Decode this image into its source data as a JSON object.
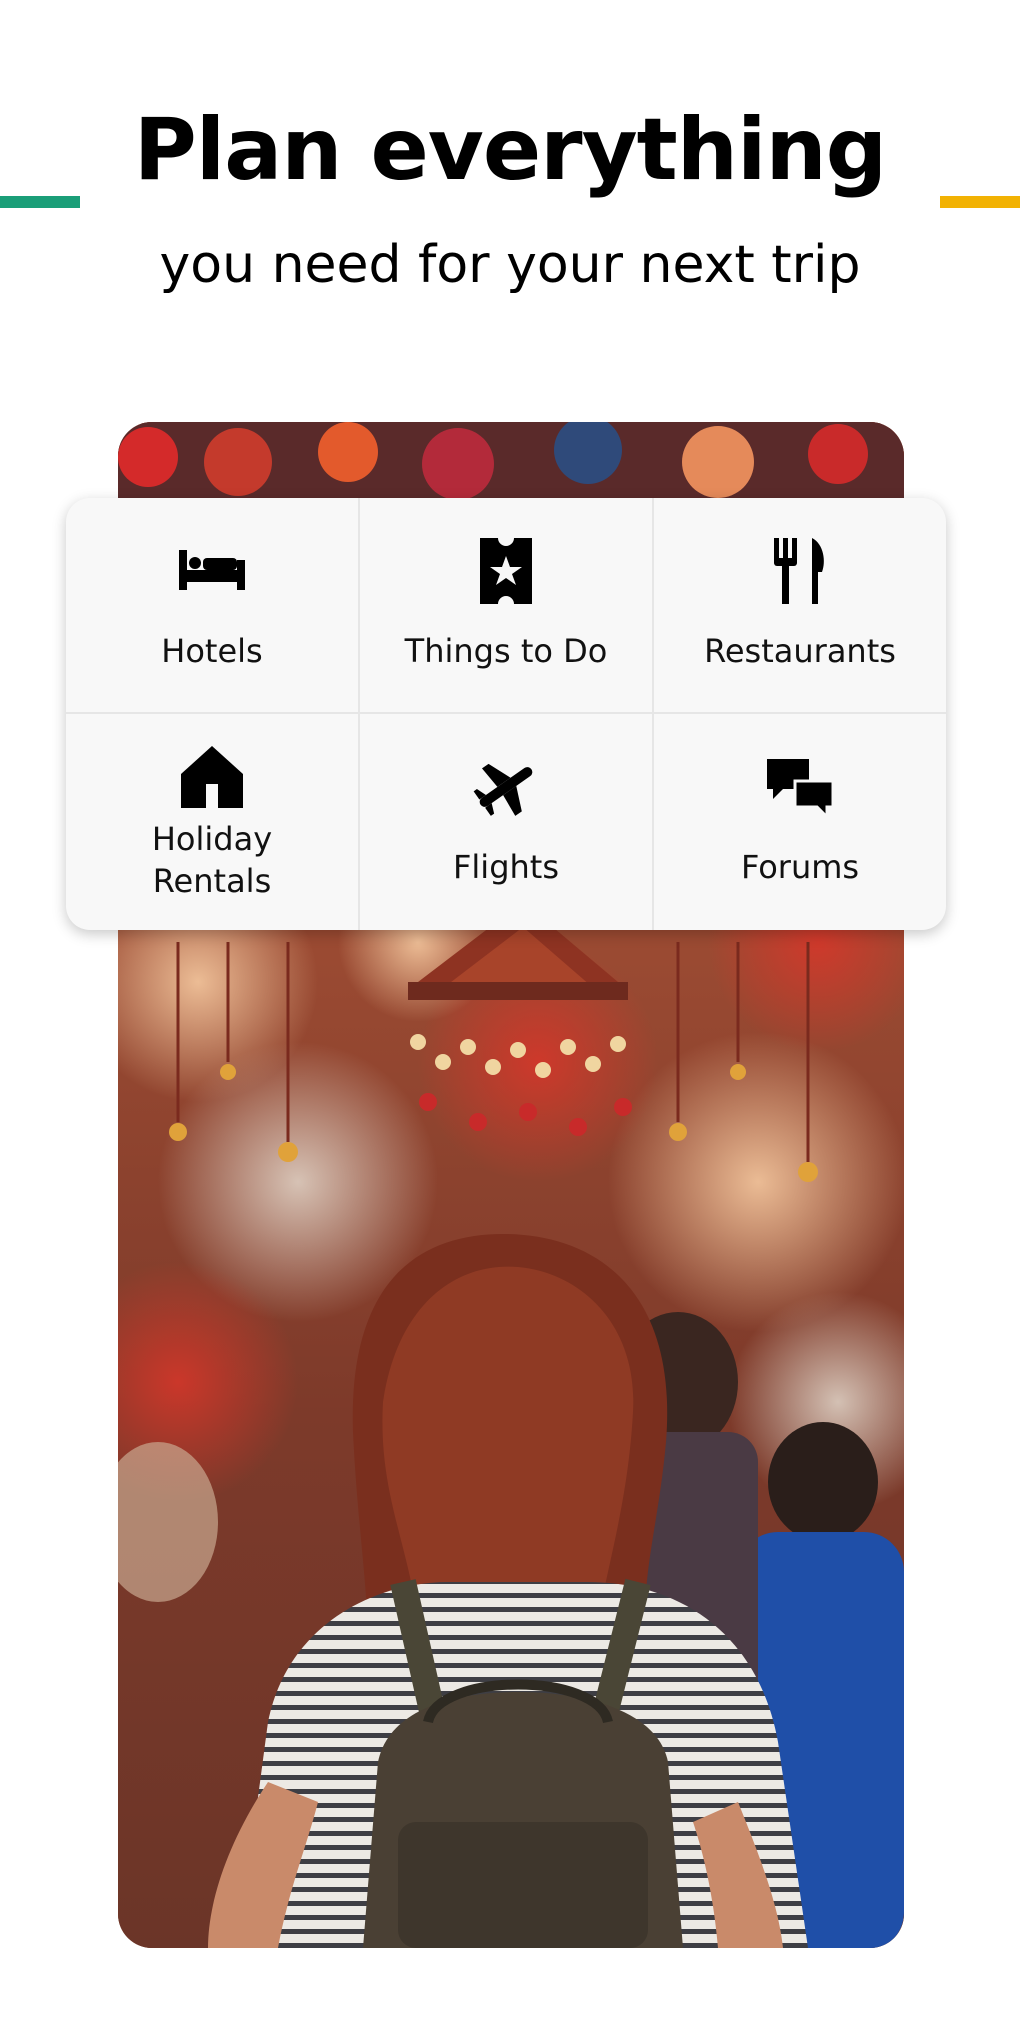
{
  "header": {
    "title": "Plan everything",
    "subtitle": "you need for your next trip"
  },
  "colors": {
    "accent_green": "#1a9e78",
    "accent_yellow": "#f2b203",
    "card_background": "#f8f8f8",
    "icon_color": "#000000"
  },
  "categories": [
    {
      "label": "Hotels",
      "icon": "bed-icon"
    },
    {
      "label": "Things to Do",
      "icon": "ticket-star-icon"
    },
    {
      "label": "Restaurants",
      "icon": "fork-knife-icon"
    },
    {
      "label": "Holiday Rentals",
      "icon": "house-icon"
    },
    {
      "label": "Flights",
      "icon": "airplane-icon"
    },
    {
      "label": "Forums",
      "icon": "chat-bubbles-icon"
    }
  ],
  "photo": {
    "subject": "market-traveler-photo"
  }
}
